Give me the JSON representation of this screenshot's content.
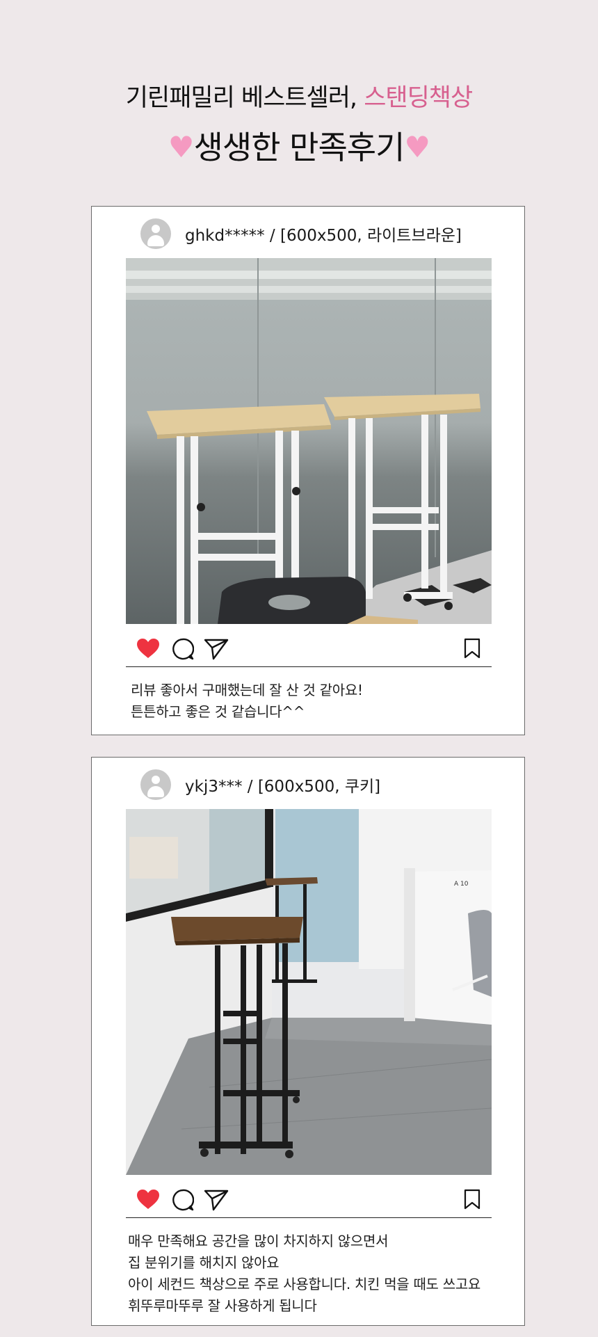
{
  "header": {
    "line1_prefix": "기린패밀리 베스트셀러, ",
    "line1_accent": "스탠딩책상",
    "line2_text": "생생한 만족후기",
    "heart_glyph": "♥",
    "accent_color": "#d7608f",
    "heart_color": "#f59ac1"
  },
  "reviews": [
    {
      "username": "ghkd***** / [600x500, 라이트브라운]",
      "photo_icon": "standing-desk-light-brown-photo",
      "caption": [
        "리뷰 좋아서 구매했는데 잘 산 것 같아요!",
        "튼튼하고 좋은 것 같습니다^^"
      ]
    },
    {
      "username": "ykj3*** / [600x500, 쿠키]",
      "photo_icon": "standing-desk-cookie-photo",
      "photo_label": "A 10",
      "caption": [
        "매우 만족해요 공간을 많이 차지하지 않으면서",
        "집 분위기를 해치지 않아요",
        "아이 세컨드 책상으로 주로 사용합니다. 치킨 먹을 때도 쓰고요",
        "휘뚜루마뚜루 잘 사용하게 됩니다"
      ]
    }
  ],
  "icons": {
    "like": "heart-icon",
    "comment": "comment-icon",
    "share": "send-icon",
    "save": "bookmark-icon",
    "like_color": "#ee3340"
  }
}
